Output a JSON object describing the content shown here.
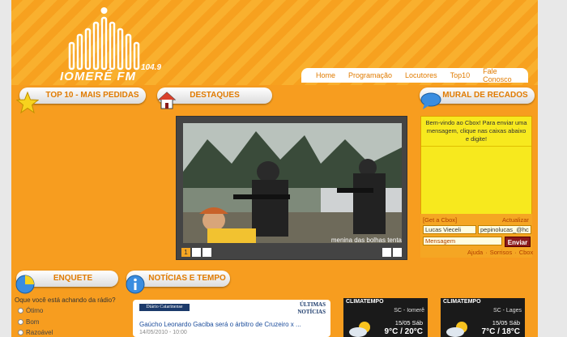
{
  "site": {
    "logo_text": "IOMERÊ FM",
    "logo_freq": "104.9"
  },
  "nav": [
    {
      "label": "Home"
    },
    {
      "label": "Programação"
    },
    {
      "label": "Locutores"
    },
    {
      "label": "Top10"
    },
    {
      "label": "Fale Conosco"
    }
  ],
  "panels": {
    "top10": "TOP 10 - MAIS PEDIDAS",
    "destaques": "DESTAQUES",
    "mural": "MURAL DE RECADOS",
    "enquete": "ENQUETE",
    "noticias": "NOTÍCIAS E TEMPO"
  },
  "slideshow": {
    "caption": "menina das bolhas tenta",
    "pages": [
      "1",
      "",
      "",
      ""
    ]
  },
  "cbox": {
    "welcome": "Bem-vindo ao Cbox! Para enviar uma mensagem, clique nas caixas abaixo e digite!",
    "get_cbox": "[Get a Cbox]",
    "refresh": "Actualizar",
    "name_value": "Lucas Vieceli",
    "email_value": "pepinolucas_@hc",
    "message_placeholder": "Mensagem",
    "send": "Enviar",
    "help": "Ajuda",
    "smilies": "Sorrisos",
    "cbox_link": "Cbox"
  },
  "poll": {
    "question": "Oque você está achando da rádio?",
    "options": [
      "Ótimo",
      "Bom",
      "Razoável"
    ]
  },
  "news": {
    "source": "Diário Catarinense",
    "latest": "ÚLTIMAS NOTÍCIAS",
    "headline": "Gaúcho Leonardo Gaciba será o árbitro de Cruzeiro x ...",
    "date": "14/05/2010 - 10:00"
  },
  "weather": [
    {
      "brand": "CLIMATEMPO",
      "location": "SC - Iomerê",
      "date": "15/05 Sáb",
      "temp": "9°C / 20°C"
    },
    {
      "brand": "CLIMATEMPO",
      "location": "SC - Lages",
      "date": "15/05 Sáb",
      "temp": "7°C / 18°C"
    }
  ],
  "colors": {
    "accent": "#f79d1f",
    "title_text": "#e07b00",
    "cbox_yellow": "#f7e91e"
  }
}
